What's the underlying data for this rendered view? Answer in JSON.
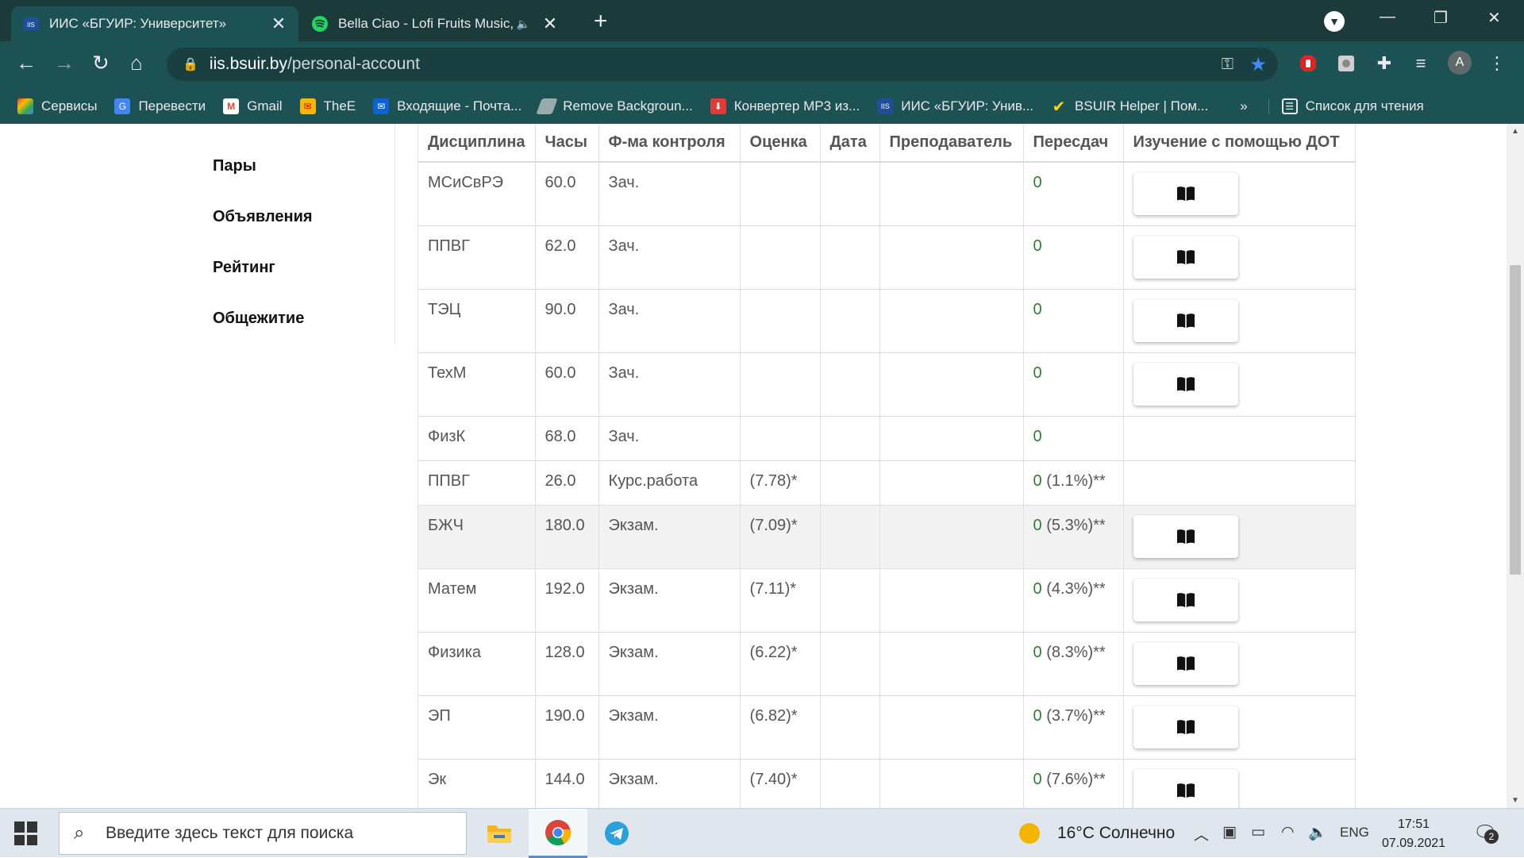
{
  "browser": {
    "tabs": [
      {
        "title": "ИИС «БГУИР: Университет»",
        "icon": "bsuir-favicon"
      },
      {
        "title": "Bella Ciao - Lofi Fruits Music,",
        "icon": "spotify-favicon"
      }
    ],
    "url": {
      "host": "iis.bsuir.by",
      "path": "/personal-account"
    },
    "bookmarks": [
      {
        "label": "Сервисы"
      },
      {
        "label": "Перевести"
      },
      {
        "label": "Gmail"
      },
      {
        "label": "TheE"
      },
      {
        "label": "Входящие - Почта..."
      },
      {
        "label": "Remove Backgroun..."
      },
      {
        "label": "Конвертер MP3 из..."
      },
      {
        "label": "ИИС «БГУИР: Унив..."
      },
      {
        "label": "BSUIR Helper | Пом..."
      }
    ],
    "bookmarks_more": "»",
    "reading_list": "Список для чтения",
    "avatar_letter": "A"
  },
  "sidebar": {
    "items": [
      "Пары",
      "Объявления",
      "Рейтинг",
      "Общежитие"
    ]
  },
  "table": {
    "headers": [
      "Дисциплина",
      "Часы",
      "Ф-ма контроля",
      "Оценка",
      "Дата",
      "Преподаватель",
      "Пересдач",
      "Изучение с помощью ДОТ"
    ],
    "rows": [
      {
        "discipline": "МСиСвРЭ",
        "hours": "60.0",
        "control": "Зач.",
        "grade": "",
        "date": "",
        "teacher": "",
        "retakes_count": "0",
        "retakes_pct": "",
        "dot": true
      },
      {
        "discipline": "ППВГ",
        "hours": "62.0",
        "control": "Зач.",
        "grade": "",
        "date": "",
        "teacher": "",
        "retakes_count": "0",
        "retakes_pct": "",
        "dot": true
      },
      {
        "discipline": "ТЭЦ",
        "hours": "90.0",
        "control": "Зач.",
        "grade": "",
        "date": "",
        "teacher": "",
        "retakes_count": "0",
        "retakes_pct": "",
        "dot": true
      },
      {
        "discipline": "ТехМ",
        "hours": "60.0",
        "control": "Зач.",
        "grade": "",
        "date": "",
        "teacher": "",
        "retakes_count": "0",
        "retakes_pct": "",
        "dot": true
      },
      {
        "discipline": "ФизК",
        "hours": "68.0",
        "control": "Зач.",
        "grade": "",
        "date": "",
        "teacher": "",
        "retakes_count": "0",
        "retakes_pct": "",
        "dot": false
      },
      {
        "discipline": "ППВГ",
        "hours": "26.0",
        "control": "Курс.работа",
        "grade": "(7.78)*",
        "date": "",
        "teacher": "",
        "retakes_count": "0",
        "retakes_pct": "(1.1%)**",
        "dot": false
      },
      {
        "discipline": "БЖЧ",
        "hours": "180.0",
        "control": "Экзам.",
        "grade": "(7.09)*",
        "date": "",
        "teacher": "",
        "retakes_count": "0",
        "retakes_pct": "(5.3%)**",
        "dot": true
      },
      {
        "discipline": "Матем",
        "hours": "192.0",
        "control": "Экзам.",
        "grade": "(7.11)*",
        "date": "",
        "teacher": "",
        "retakes_count": "0",
        "retakes_pct": "(4.3%)**",
        "dot": true
      },
      {
        "discipline": "Физика",
        "hours": "128.0",
        "control": "Экзам.",
        "grade": "(6.22)*",
        "date": "",
        "teacher": "",
        "retakes_count": "0",
        "retakes_pct": "(8.3%)**",
        "dot": true
      },
      {
        "discipline": "ЭП",
        "hours": "190.0",
        "control": "Экзам.",
        "grade": "(6.82)*",
        "date": "",
        "teacher": "",
        "retakes_count": "0",
        "retakes_pct": "(3.7%)**",
        "dot": true
      },
      {
        "discipline": "Эк",
        "hours": "144.0",
        "control": "Экзам.",
        "grade": "(7.40)*",
        "date": "",
        "teacher": "",
        "retakes_count": "0",
        "retakes_pct": "(7.6%)**",
        "dot": true
      }
    ]
  },
  "taskbar": {
    "search_placeholder": "Введите здесь текст для поиска",
    "weather": "16°C  Солнечно",
    "language": "ENG",
    "time": "17:51",
    "date": "07.09.2021",
    "notifications": "2"
  },
  "colors": {
    "accent_green": "#2e7d32",
    "chrome_dark": "#1b3a3a",
    "chrome_toolbar": "#1d5254"
  }
}
